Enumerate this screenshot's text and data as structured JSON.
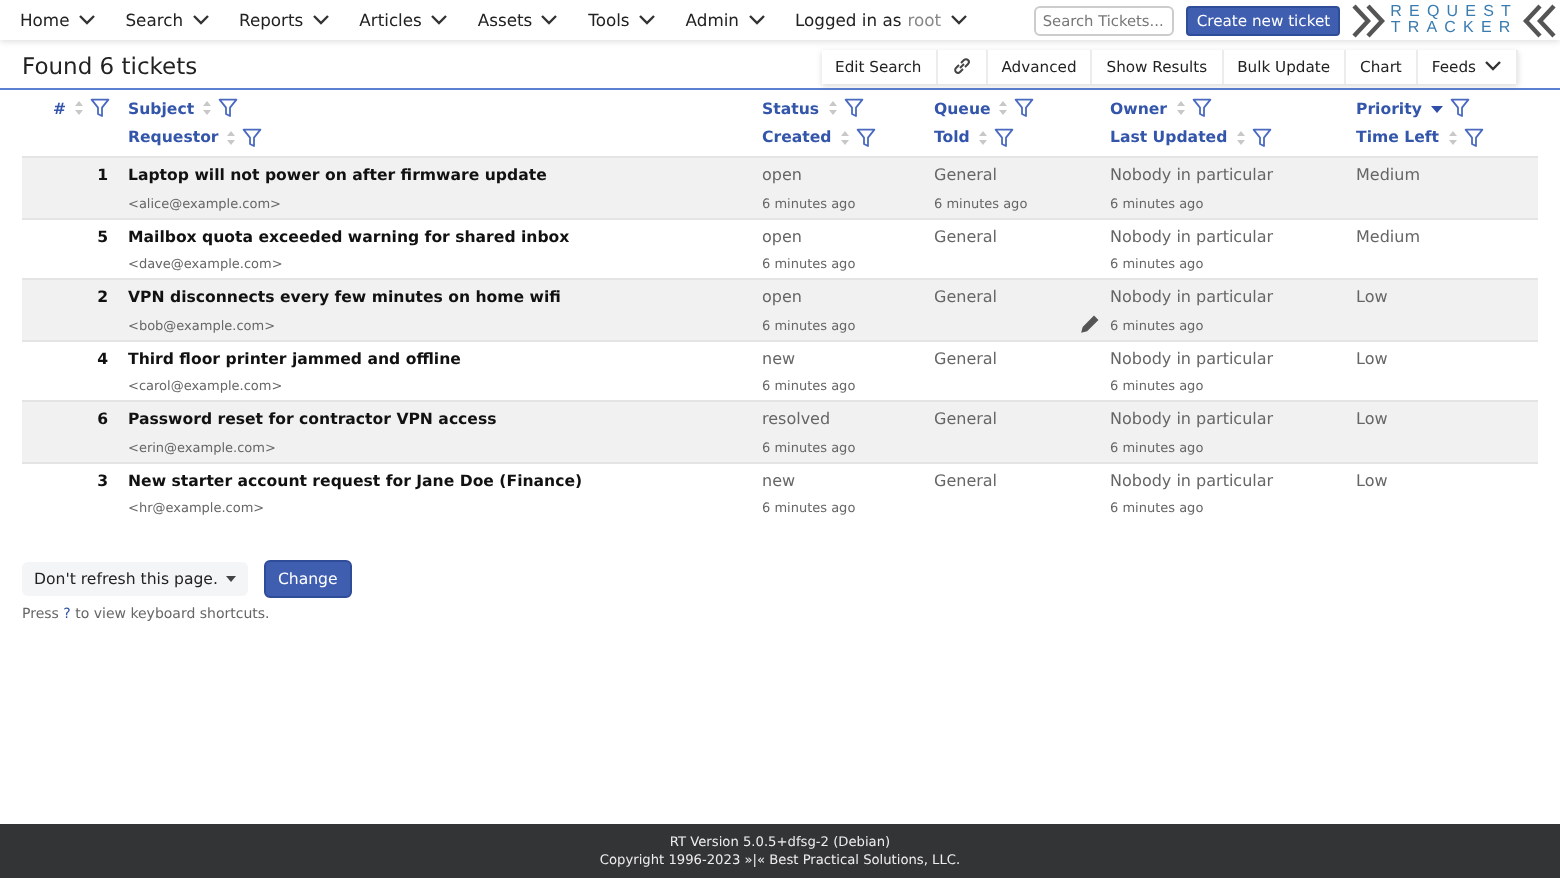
{
  "nav": {
    "menus": [
      {
        "label": "Home"
      },
      {
        "label": "Search"
      },
      {
        "label": "Reports"
      },
      {
        "label": "Articles"
      },
      {
        "label": "Assets"
      },
      {
        "label": "Tools"
      },
      {
        "label": "Admin"
      }
    ],
    "logged_in": {
      "label": "Logged in as",
      "user": "root"
    },
    "search": {
      "placeholder": "Search Tickets..."
    },
    "create_button": "Create new ticket",
    "logo": {
      "top": "REQUEST",
      "bottom": "TRACKER"
    }
  },
  "title": "Found 6 tickets",
  "toolbar": [
    {
      "kind": "text",
      "label": "Edit Search"
    },
    {
      "kind": "link-icon"
    },
    {
      "kind": "text",
      "label": "Advanced"
    },
    {
      "kind": "text",
      "label": "Show Results"
    },
    {
      "kind": "text",
      "label": "Bulk Update"
    },
    {
      "kind": "text",
      "label": "Chart"
    },
    {
      "kind": "menu",
      "label": "Feeds"
    }
  ],
  "table": {
    "header_rows": [
      [
        {
          "label": "#",
          "sorted": false
        },
        {
          "label": "Subject",
          "sorted": false
        },
        {
          "label": "Status",
          "sorted": false
        },
        {
          "label": "Queue",
          "sorted": false
        },
        {
          "label": "Owner",
          "sorted": false
        },
        {
          "label": "Priority",
          "sorted": true
        }
      ],
      [
        null,
        {
          "label": "Requestor",
          "sorted": false
        },
        {
          "label": "Created",
          "sorted": false
        },
        {
          "label": "Told",
          "sorted": false
        },
        {
          "label": "Last Updated",
          "sorted": false
        },
        {
          "label": "Time Left",
          "sorted": false
        }
      ]
    ],
    "rows": [
      {
        "id": "1",
        "subject": "Laptop will not power on after firmware update",
        "requestor": "<alice@example.com>",
        "status": "open",
        "created": "6 minutes ago",
        "queue": "General",
        "told": "6 minutes ago",
        "owner": "Nobody in particular",
        "last_updated": "6 minutes ago",
        "priority": "Medium",
        "edit_icon": false
      },
      {
        "id": "5",
        "subject": "Mailbox quota exceeded warning for shared inbox",
        "requestor": "<dave@example.com>",
        "status": "open",
        "created": "6 minutes ago",
        "queue": "General",
        "owner": "Nobody in particular",
        "last_updated": "6 minutes ago",
        "priority": "Medium",
        "edit_icon": false
      },
      {
        "id": "2",
        "subject": "VPN disconnects every few minutes on home wifi",
        "requestor": "<bob@example.com>",
        "status": "open",
        "created": "6 minutes ago",
        "queue": "General",
        "owner": "Nobody in particular",
        "last_updated": "6 minutes ago",
        "priority": "Low",
        "edit_icon": true
      },
      {
        "id": "4",
        "subject": "Third floor printer jammed and offline",
        "requestor": "<carol@example.com>",
        "status": "new",
        "created": "6 minutes ago",
        "queue": "General",
        "owner": "Nobody in particular",
        "last_updated": "6 minutes ago",
        "priority": "Low",
        "edit_icon": false
      },
      {
        "id": "6",
        "subject": "Password reset for contractor VPN access",
        "requestor": "<erin@example.com>",
        "status": "resolved",
        "created": "6 minutes ago",
        "queue": "General",
        "owner": "Nobody in particular",
        "last_updated": "6 minutes ago",
        "priority": "Low",
        "edit_icon": false
      },
      {
        "id": "3",
        "subject": "New starter account request for Jane Doe (Finance)",
        "requestor": "<hr@example.com>",
        "status": "new",
        "created": "6 minutes ago",
        "queue": "General",
        "owner": "Nobody in particular",
        "last_updated": "6 minutes ago",
        "priority": "Low",
        "edit_icon": false
      }
    ]
  },
  "refresh": {
    "value": "Don't refresh this page.",
    "button": "Change"
  },
  "hint": {
    "before": "Press",
    "key": "?",
    "after": "to view keyboard shortcuts."
  },
  "footer": [
    "RT Version 5.0.5+dfsg-2 (Debian)",
    "Copyright 1996-2023 »|« Best Practical Solutions, LLC."
  ]
}
